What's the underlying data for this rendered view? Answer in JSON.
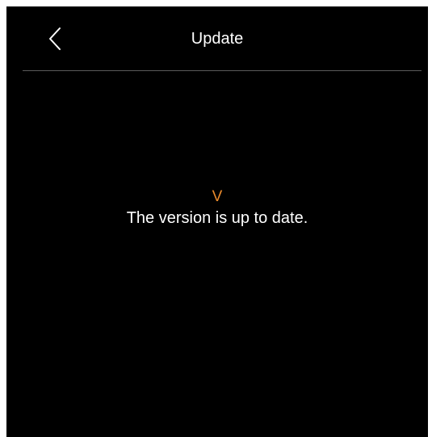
{
  "header": {
    "title": "Update",
    "back_icon": "chevron-left-icon"
  },
  "status": {
    "icon_glyph": "V",
    "icon_color": "#e8892c",
    "message": "The version is up to date."
  },
  "colors": {
    "background": "#000000",
    "text": "#ffffff",
    "accent": "#e8892c",
    "divider": "#5a5a5a"
  }
}
